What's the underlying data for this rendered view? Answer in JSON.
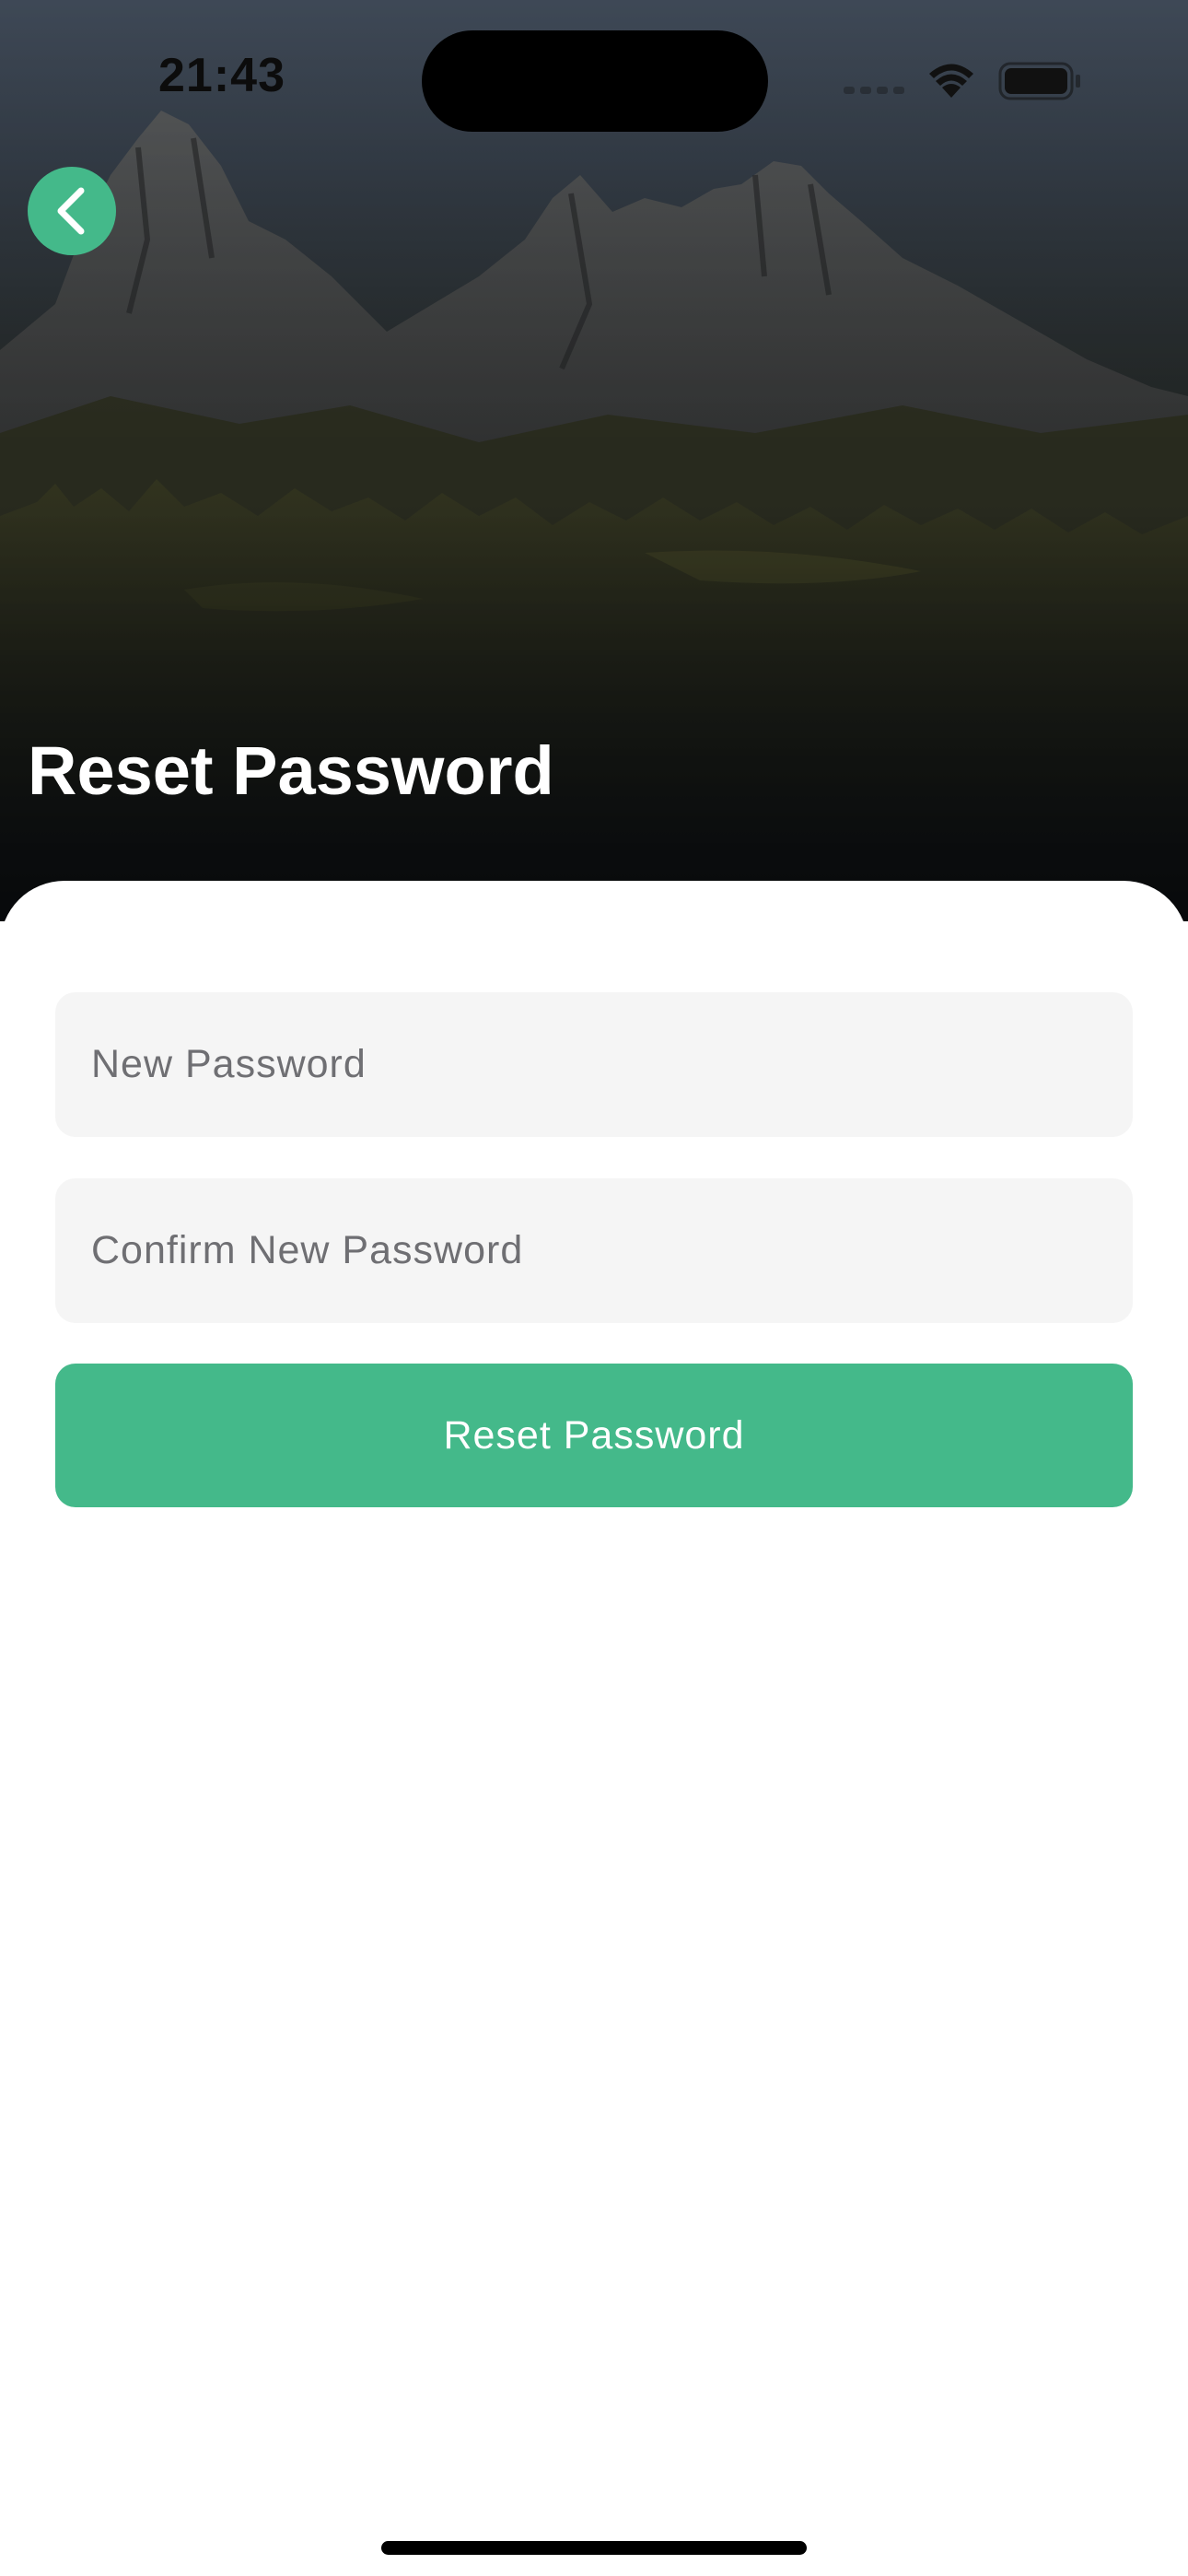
{
  "status_bar": {
    "time": "21:43"
  },
  "hero": {
    "title": "Reset Password",
    "back_icon": "chevron-left-icon"
  },
  "form": {
    "new_password": {
      "value": "",
      "placeholder": "New Password"
    },
    "confirm_password": {
      "value": "",
      "placeholder": "Confirm New Password"
    },
    "submit_label": "Reset Password"
  },
  "colors": {
    "accent": "#44b98a",
    "field_background": "#f5f5f5",
    "sheet_background": "#ffffff",
    "placeholder_text": "#6f6f73"
  }
}
